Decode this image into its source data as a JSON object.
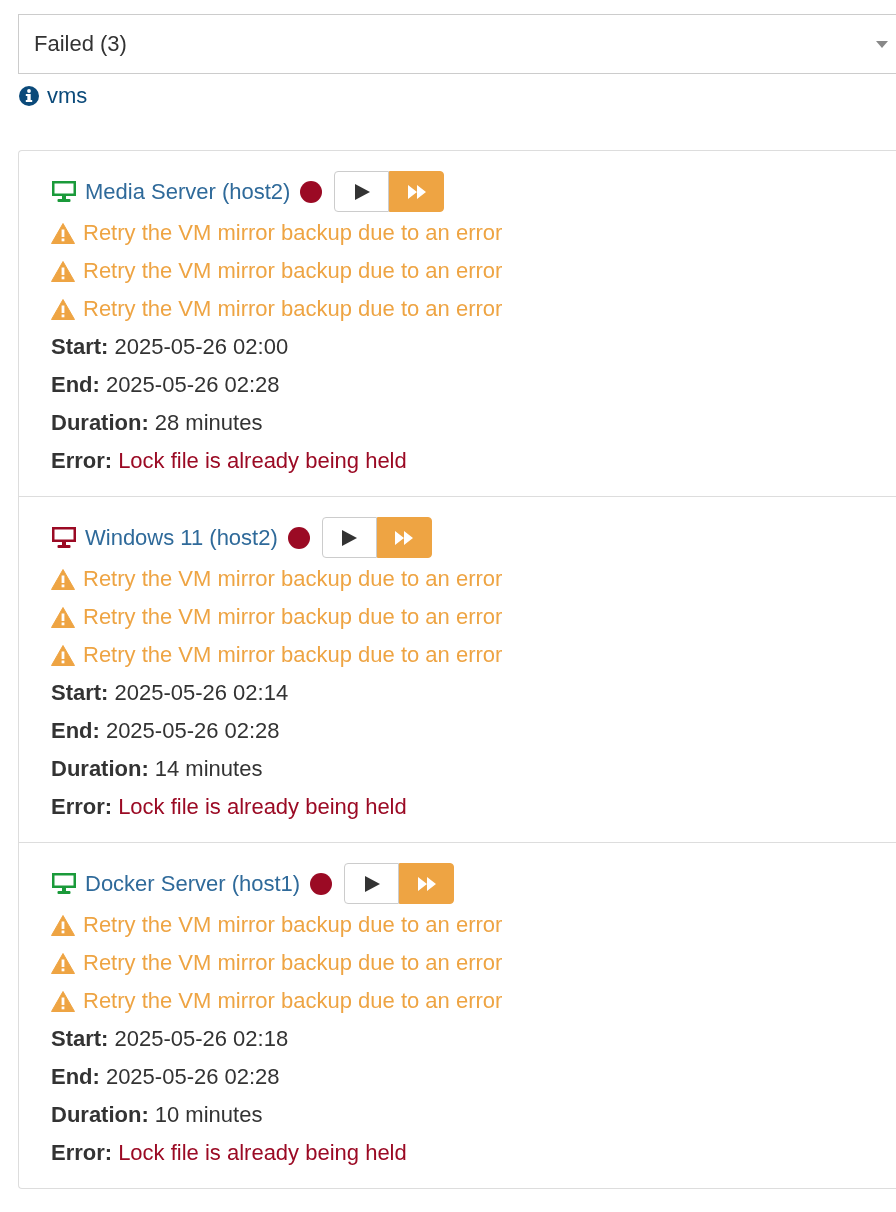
{
  "filter": {
    "value": "Failed (3)"
  },
  "info_link": {
    "label": "vms"
  },
  "vms": [
    {
      "name": "Media Server (host2)",
      "color": "#1a9a3a",
      "messages": [
        "Retry the VM mirror backup due to an error",
        "Retry the VM mirror backup due to an error",
        "Retry the VM mirror backup due to an error"
      ],
      "fields": [
        {
          "label": "Start:",
          "value": "2025-05-26 02:00",
          "kind": "plain"
        },
        {
          "label": "End:",
          "value": "2025-05-26 02:28",
          "kind": "plain"
        },
        {
          "label": "Duration:",
          "value": "28 minutes",
          "kind": "plain"
        },
        {
          "label": "Error:",
          "value": "Lock file is already being held",
          "kind": "error"
        }
      ]
    },
    {
      "name": "Windows 11 (host2)",
      "color": "#9b0a24",
      "messages": [
        "Retry the VM mirror backup due to an error",
        "Retry the VM mirror backup due to an error",
        "Retry the VM mirror backup due to an error"
      ],
      "fields": [
        {
          "label": "Start:",
          "value": "2025-05-26 02:14",
          "kind": "plain"
        },
        {
          "label": "End:",
          "value": "2025-05-26 02:28",
          "kind": "plain"
        },
        {
          "label": "Duration:",
          "value": "14 minutes",
          "kind": "plain"
        },
        {
          "label": "Error:",
          "value": "Lock file is already being held",
          "kind": "error"
        }
      ]
    },
    {
      "name": "Docker Server (host1)",
      "color": "#1a9a3a",
      "messages": [
        "Retry the VM mirror backup due to an error",
        "Retry the VM mirror backup due to an error",
        "Retry the VM mirror backup due to an error"
      ],
      "fields": [
        {
          "label": "Start:",
          "value": "2025-05-26 02:18",
          "kind": "plain"
        },
        {
          "label": "End:",
          "value": "2025-05-26 02:28",
          "kind": "plain"
        },
        {
          "label": "Duration:",
          "value": "10 minutes",
          "kind": "plain"
        },
        {
          "label": "Error:",
          "value": "Lock file is already being held",
          "kind": "error"
        }
      ]
    }
  ]
}
